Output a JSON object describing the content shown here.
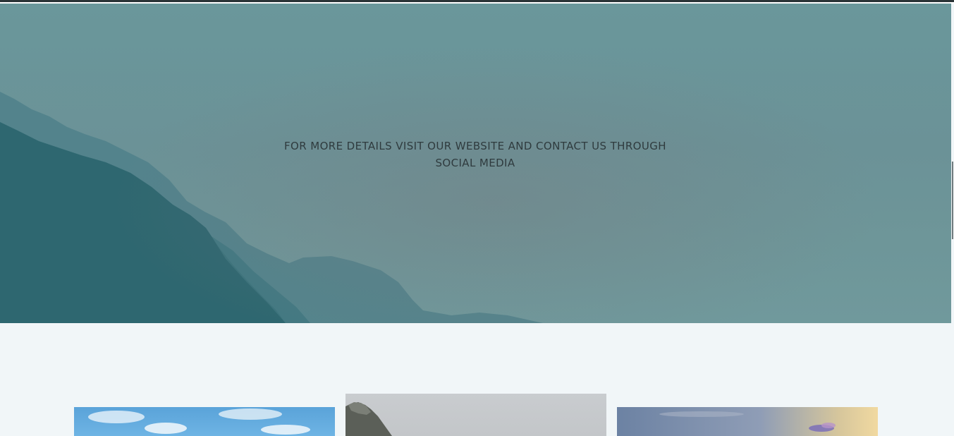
{
  "hero": {
    "message_line1": "FOR MORE DETAILS VISIT OUR WEBSITE AND CONTACT US THROUGH",
    "message_line2": "SOCIAL MEDIA"
  },
  "colors": {
    "hero_bg": "#6b9297",
    "mountain_far": "#4f8089",
    "mountain_near": "#2e6770",
    "page_bg": "#f1f6f8",
    "text": "#2f3b3e"
  },
  "gallery": {
    "cards": [
      {
        "name": "gallery-image-sky"
      },
      {
        "name": "gallery-image-cliff"
      },
      {
        "name": "gallery-image-sunset"
      }
    ]
  }
}
